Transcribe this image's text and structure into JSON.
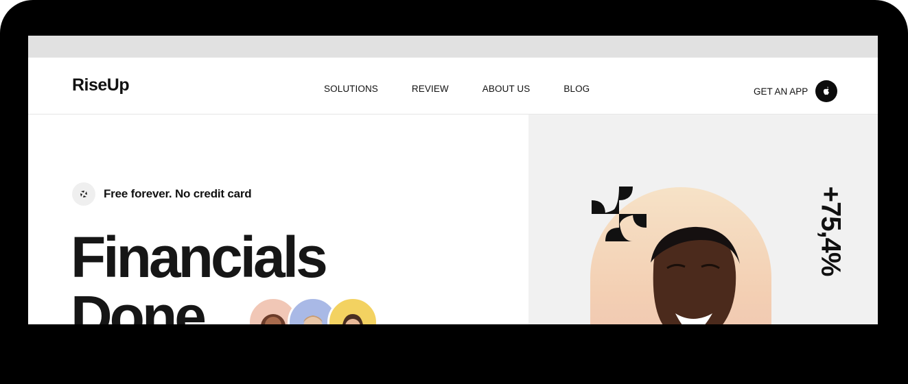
{
  "brand": {
    "logo": "RiseUp"
  },
  "nav": {
    "items": [
      {
        "label": "SOLUTIONS"
      },
      {
        "label": "REVIEW"
      },
      {
        "label": "ABOUT US"
      },
      {
        "label": "BLOG"
      }
    ],
    "cta_label": "GET AN APP",
    "cta_icon": "app-store-icon"
  },
  "hero": {
    "badge_text": "Free forever. No credit card",
    "badge_icon": "spinner-arrows-icon",
    "headline_line1": "Financials",
    "headline_line2": "Done",
    "stat": "+75,4%"
  },
  "colors": {
    "bezel": "#000000",
    "text": "#111111",
    "right_panel": "#f1f1f1",
    "arch_top": "#f6e2c7",
    "avatar_1_bg": "#f1c7b6",
    "avatar_2_bg": "#a9b9e6",
    "avatar_3_bg": "#f3d261"
  }
}
